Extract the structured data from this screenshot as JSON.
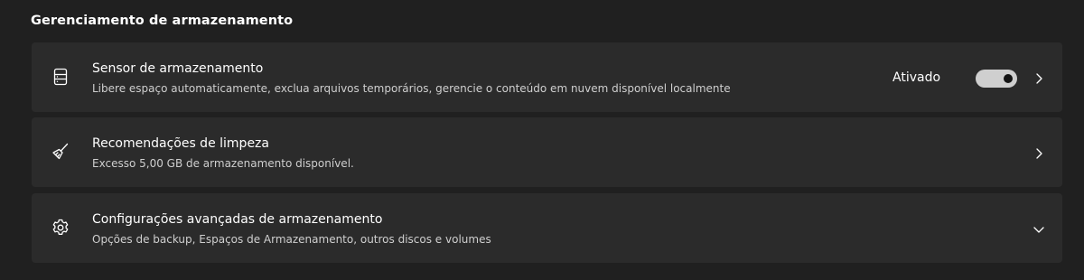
{
  "section": {
    "title": "Gerenciamento de armazenamento"
  },
  "cards": [
    {
      "icon": "storage-drive-icon",
      "title": "Sensor de armazenamento",
      "description": "Libere espaço automaticamente, exclua arquivos temporários, gerencie o conteúdo em nuvem disponível localmente",
      "status": "Ativado",
      "toggle_on": true,
      "chevron": "chevron-right-icon"
    },
    {
      "icon": "broom-icon",
      "title": "Recomendações de limpeza",
      "description": "Excesso 5,00 GB de armazenamento disponível.",
      "chevron": "chevron-right-icon"
    },
    {
      "icon": "gear-icon",
      "title": "Configurações avançadas de armazenamento",
      "description": "Opções de backup, Espaços de Armazenamento, outros discos e volumes",
      "chevron": "chevron-down-icon"
    }
  ],
  "colors": {
    "background": "#202020",
    "card": "#2b2b2b",
    "toggle_track": "#cfcfcf",
    "toggle_knob": "#141414"
  }
}
